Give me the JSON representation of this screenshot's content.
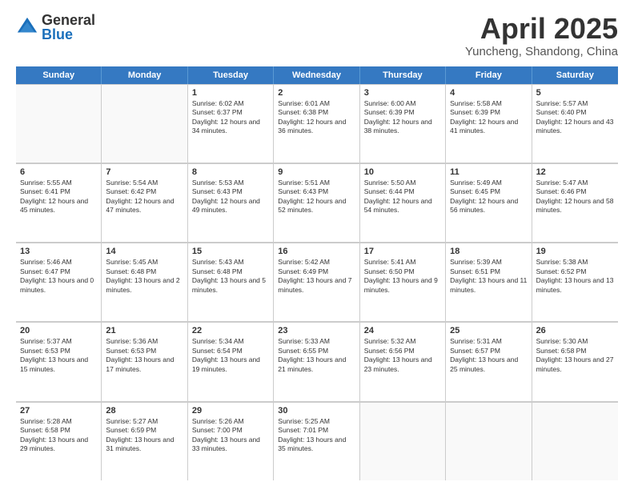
{
  "logo": {
    "general": "General",
    "blue": "Blue"
  },
  "title": "April 2025",
  "subtitle": "Yuncheng, Shandong, China",
  "headers": [
    "Sunday",
    "Monday",
    "Tuesday",
    "Wednesday",
    "Thursday",
    "Friday",
    "Saturday"
  ],
  "weeks": [
    [
      {
        "day": "",
        "sunrise": "",
        "sunset": "",
        "daylight": ""
      },
      {
        "day": "",
        "sunrise": "",
        "sunset": "",
        "daylight": ""
      },
      {
        "day": "1",
        "sunrise": "Sunrise: 6:02 AM",
        "sunset": "Sunset: 6:37 PM",
        "daylight": "Daylight: 12 hours and 34 minutes."
      },
      {
        "day": "2",
        "sunrise": "Sunrise: 6:01 AM",
        "sunset": "Sunset: 6:38 PM",
        "daylight": "Daylight: 12 hours and 36 minutes."
      },
      {
        "day": "3",
        "sunrise": "Sunrise: 6:00 AM",
        "sunset": "Sunset: 6:39 PM",
        "daylight": "Daylight: 12 hours and 38 minutes."
      },
      {
        "day": "4",
        "sunrise": "Sunrise: 5:58 AM",
        "sunset": "Sunset: 6:39 PM",
        "daylight": "Daylight: 12 hours and 41 minutes."
      },
      {
        "day": "5",
        "sunrise": "Sunrise: 5:57 AM",
        "sunset": "Sunset: 6:40 PM",
        "daylight": "Daylight: 12 hours and 43 minutes."
      }
    ],
    [
      {
        "day": "6",
        "sunrise": "Sunrise: 5:55 AM",
        "sunset": "Sunset: 6:41 PM",
        "daylight": "Daylight: 12 hours and 45 minutes."
      },
      {
        "day": "7",
        "sunrise": "Sunrise: 5:54 AM",
        "sunset": "Sunset: 6:42 PM",
        "daylight": "Daylight: 12 hours and 47 minutes."
      },
      {
        "day": "8",
        "sunrise": "Sunrise: 5:53 AM",
        "sunset": "Sunset: 6:43 PM",
        "daylight": "Daylight: 12 hours and 49 minutes."
      },
      {
        "day": "9",
        "sunrise": "Sunrise: 5:51 AM",
        "sunset": "Sunset: 6:43 PM",
        "daylight": "Daylight: 12 hours and 52 minutes."
      },
      {
        "day": "10",
        "sunrise": "Sunrise: 5:50 AM",
        "sunset": "Sunset: 6:44 PM",
        "daylight": "Daylight: 12 hours and 54 minutes."
      },
      {
        "day": "11",
        "sunrise": "Sunrise: 5:49 AM",
        "sunset": "Sunset: 6:45 PM",
        "daylight": "Daylight: 12 hours and 56 minutes."
      },
      {
        "day": "12",
        "sunrise": "Sunrise: 5:47 AM",
        "sunset": "Sunset: 6:46 PM",
        "daylight": "Daylight: 12 hours and 58 minutes."
      }
    ],
    [
      {
        "day": "13",
        "sunrise": "Sunrise: 5:46 AM",
        "sunset": "Sunset: 6:47 PM",
        "daylight": "Daylight: 13 hours and 0 minutes."
      },
      {
        "day": "14",
        "sunrise": "Sunrise: 5:45 AM",
        "sunset": "Sunset: 6:48 PM",
        "daylight": "Daylight: 13 hours and 2 minutes."
      },
      {
        "day": "15",
        "sunrise": "Sunrise: 5:43 AM",
        "sunset": "Sunset: 6:48 PM",
        "daylight": "Daylight: 13 hours and 5 minutes."
      },
      {
        "day": "16",
        "sunrise": "Sunrise: 5:42 AM",
        "sunset": "Sunset: 6:49 PM",
        "daylight": "Daylight: 13 hours and 7 minutes."
      },
      {
        "day": "17",
        "sunrise": "Sunrise: 5:41 AM",
        "sunset": "Sunset: 6:50 PM",
        "daylight": "Daylight: 13 hours and 9 minutes."
      },
      {
        "day": "18",
        "sunrise": "Sunrise: 5:39 AM",
        "sunset": "Sunset: 6:51 PM",
        "daylight": "Daylight: 13 hours and 11 minutes."
      },
      {
        "day": "19",
        "sunrise": "Sunrise: 5:38 AM",
        "sunset": "Sunset: 6:52 PM",
        "daylight": "Daylight: 13 hours and 13 minutes."
      }
    ],
    [
      {
        "day": "20",
        "sunrise": "Sunrise: 5:37 AM",
        "sunset": "Sunset: 6:53 PM",
        "daylight": "Daylight: 13 hours and 15 minutes."
      },
      {
        "day": "21",
        "sunrise": "Sunrise: 5:36 AM",
        "sunset": "Sunset: 6:53 PM",
        "daylight": "Daylight: 13 hours and 17 minutes."
      },
      {
        "day": "22",
        "sunrise": "Sunrise: 5:34 AM",
        "sunset": "Sunset: 6:54 PM",
        "daylight": "Daylight: 13 hours and 19 minutes."
      },
      {
        "day": "23",
        "sunrise": "Sunrise: 5:33 AM",
        "sunset": "Sunset: 6:55 PM",
        "daylight": "Daylight: 13 hours and 21 minutes."
      },
      {
        "day": "24",
        "sunrise": "Sunrise: 5:32 AM",
        "sunset": "Sunset: 6:56 PM",
        "daylight": "Daylight: 13 hours and 23 minutes."
      },
      {
        "day": "25",
        "sunrise": "Sunrise: 5:31 AM",
        "sunset": "Sunset: 6:57 PM",
        "daylight": "Daylight: 13 hours and 25 minutes."
      },
      {
        "day": "26",
        "sunrise": "Sunrise: 5:30 AM",
        "sunset": "Sunset: 6:58 PM",
        "daylight": "Daylight: 13 hours and 27 minutes."
      }
    ],
    [
      {
        "day": "27",
        "sunrise": "Sunrise: 5:28 AM",
        "sunset": "Sunset: 6:58 PM",
        "daylight": "Daylight: 13 hours and 29 minutes."
      },
      {
        "day": "28",
        "sunrise": "Sunrise: 5:27 AM",
        "sunset": "Sunset: 6:59 PM",
        "daylight": "Daylight: 13 hours and 31 minutes."
      },
      {
        "day": "29",
        "sunrise": "Sunrise: 5:26 AM",
        "sunset": "Sunset: 7:00 PM",
        "daylight": "Daylight: 13 hours and 33 minutes."
      },
      {
        "day": "30",
        "sunrise": "Sunrise: 5:25 AM",
        "sunset": "Sunset: 7:01 PM",
        "daylight": "Daylight: 13 hours and 35 minutes."
      },
      {
        "day": "",
        "sunrise": "",
        "sunset": "",
        "daylight": ""
      },
      {
        "day": "",
        "sunrise": "",
        "sunset": "",
        "daylight": ""
      },
      {
        "day": "",
        "sunrise": "",
        "sunset": "",
        "daylight": ""
      }
    ]
  ]
}
